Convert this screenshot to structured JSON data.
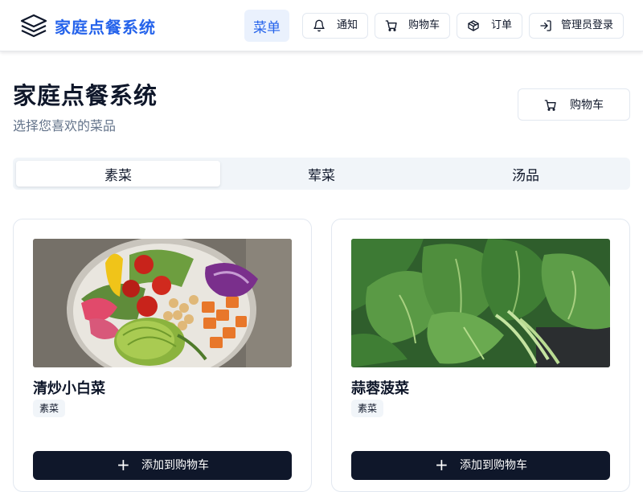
{
  "header": {
    "brand_title": "家庭点餐系统",
    "brand_color": "#2563eb",
    "nav": {
      "menu": "菜单",
      "notifications": "通知",
      "cart": "购物车",
      "orders": "订单",
      "admin_login": "管理员登录"
    },
    "icons": [
      "layers-icon",
      "bell-icon",
      "cart-icon",
      "package-icon",
      "login-icon"
    ]
  },
  "page": {
    "title": "家庭点餐系统",
    "subtitle": "选择您喜欢的菜品",
    "cart_button": "购物车"
  },
  "tabs": [
    {
      "label": "素菜",
      "active": true
    },
    {
      "label": "荤菜",
      "active": false
    },
    {
      "label": "汤品",
      "active": false
    }
  ],
  "dishes": [
    {
      "name": "清炒小白菜",
      "tag": "素菜",
      "add_label": "添加到购物车",
      "image": "salad-bowl"
    },
    {
      "name": "蒜蓉菠菜",
      "tag": "素菜",
      "add_label": "添加到购物车",
      "image": "fresh-spinach"
    }
  ],
  "colors": {
    "primary_dark": "#0f172a",
    "muted_text": "#64748b",
    "tab_bg": "#f1f5f9"
  }
}
